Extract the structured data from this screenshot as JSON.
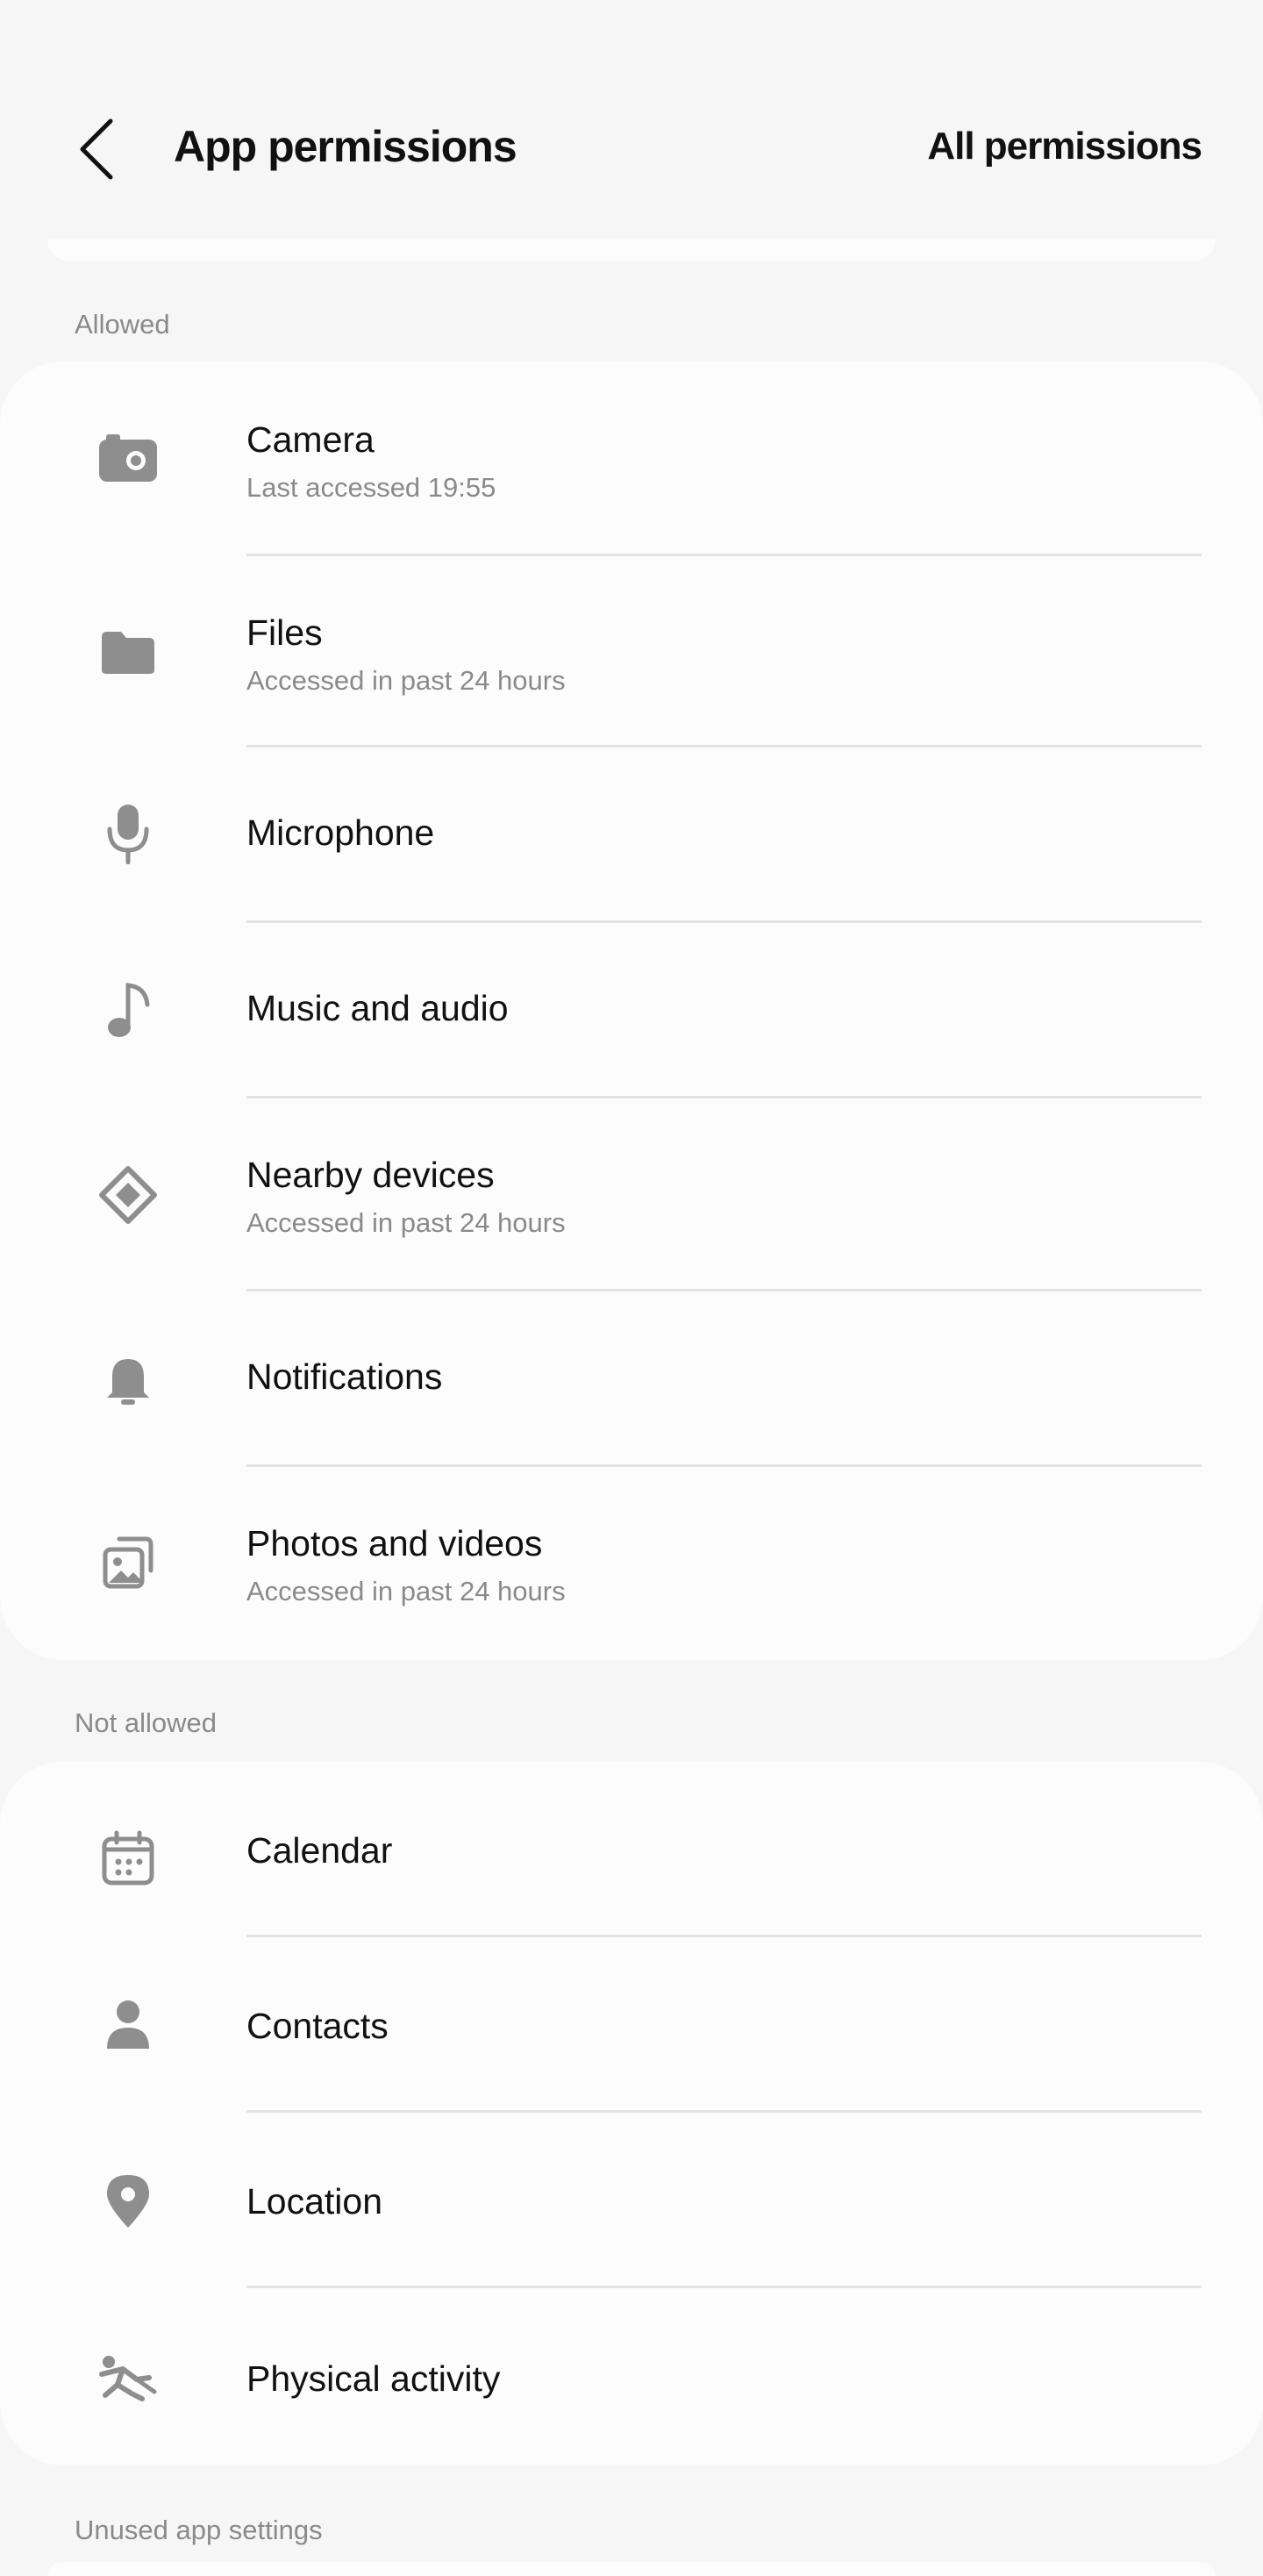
{
  "header": {
    "title": "App permissions",
    "action_label": "All permissions"
  },
  "sections": {
    "allowed": {
      "label": "Allowed",
      "items": [
        {
          "name": "Camera",
          "sub": "Last accessed 19:55",
          "icon": "camera-icon"
        },
        {
          "name": "Files",
          "sub": "Accessed in past 24 hours",
          "icon": "folder-icon"
        },
        {
          "name": "Microphone",
          "icon": "microphone-icon"
        },
        {
          "name": "Music and audio",
          "icon": "music-note-icon"
        },
        {
          "name": "Nearby devices",
          "sub": "Accessed in past 24 hours",
          "icon": "nearby-devices-icon"
        },
        {
          "name": "Notifications",
          "icon": "bell-icon"
        },
        {
          "name": "Photos and videos",
          "sub": "Accessed in past 24 hours",
          "icon": "photos-icon"
        }
      ]
    },
    "not_allowed": {
      "label": "Not allowed",
      "items": [
        {
          "name": "Calendar",
          "icon": "calendar-icon"
        },
        {
          "name": "Contacts",
          "icon": "person-icon"
        },
        {
          "name": "Location",
          "icon": "location-pin-icon"
        },
        {
          "name": "Physical activity",
          "icon": "physical-activity-icon"
        }
      ]
    },
    "unused": {
      "label": "Unused app settings"
    }
  },
  "colors": {
    "background": "#f6f6f6",
    "card": "#fcfcfc",
    "icon": "#8e8e8e",
    "secondary_text": "#8a8a8a"
  }
}
